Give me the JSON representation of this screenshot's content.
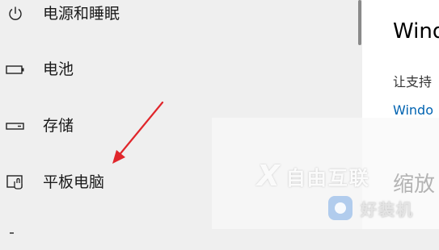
{
  "sidebar": {
    "items": [
      {
        "label": "电源和睡眠",
        "icon": "power-icon"
      },
      {
        "label": "电池",
        "icon": "battery-icon"
      },
      {
        "label": "存储",
        "icon": "storage-icon"
      },
      {
        "label": "平板电脑",
        "icon": "tablet-mode-icon"
      }
    ]
  },
  "content": {
    "title": "Wind",
    "description": "让支持",
    "link": "Windo",
    "subheading": "缩放"
  },
  "watermark": {
    "brand_mark": "X",
    "brand_text": "自由互联",
    "secondary_text": "好装机"
  },
  "colors": {
    "sidebar_bg": "#efefef",
    "content_bg": "#ffffff",
    "link": "#0063b1",
    "arrow": "#e0262b"
  }
}
